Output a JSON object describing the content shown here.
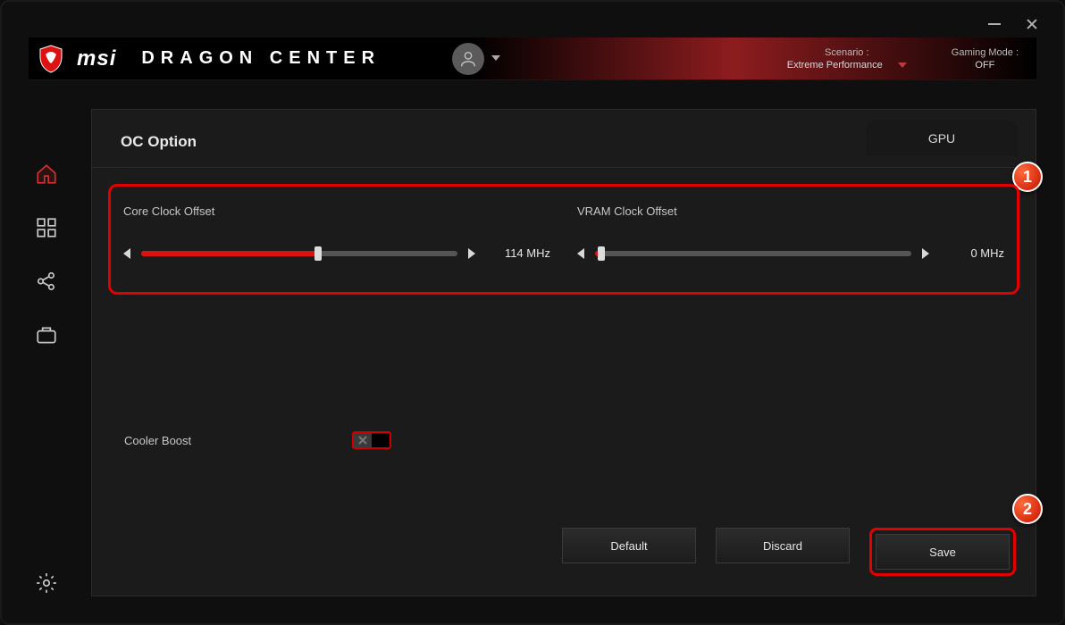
{
  "brand": "msi",
  "appTitle": "DRAGON CENTER",
  "header": {
    "scenario": {
      "label": "Scenario :",
      "value": "Extreme Performance"
    },
    "gamingMode": {
      "label": "Gaming Mode :",
      "value": "OFF"
    }
  },
  "panel": {
    "title": "OC Option",
    "tab": "GPU"
  },
  "sliders": {
    "core": {
      "label": "Core Clock Offset",
      "value": "114 MHz",
      "fillPct": 56
    },
    "vram": {
      "label": "VRAM Clock Offset",
      "value": "0 MHz",
      "fillPct": 2
    }
  },
  "coolerBoost": {
    "label": "Cooler Boost"
  },
  "buttons": {
    "default": "Default",
    "discard": "Discard",
    "save": "Save"
  },
  "annotations": {
    "one": "1",
    "two": "2"
  }
}
